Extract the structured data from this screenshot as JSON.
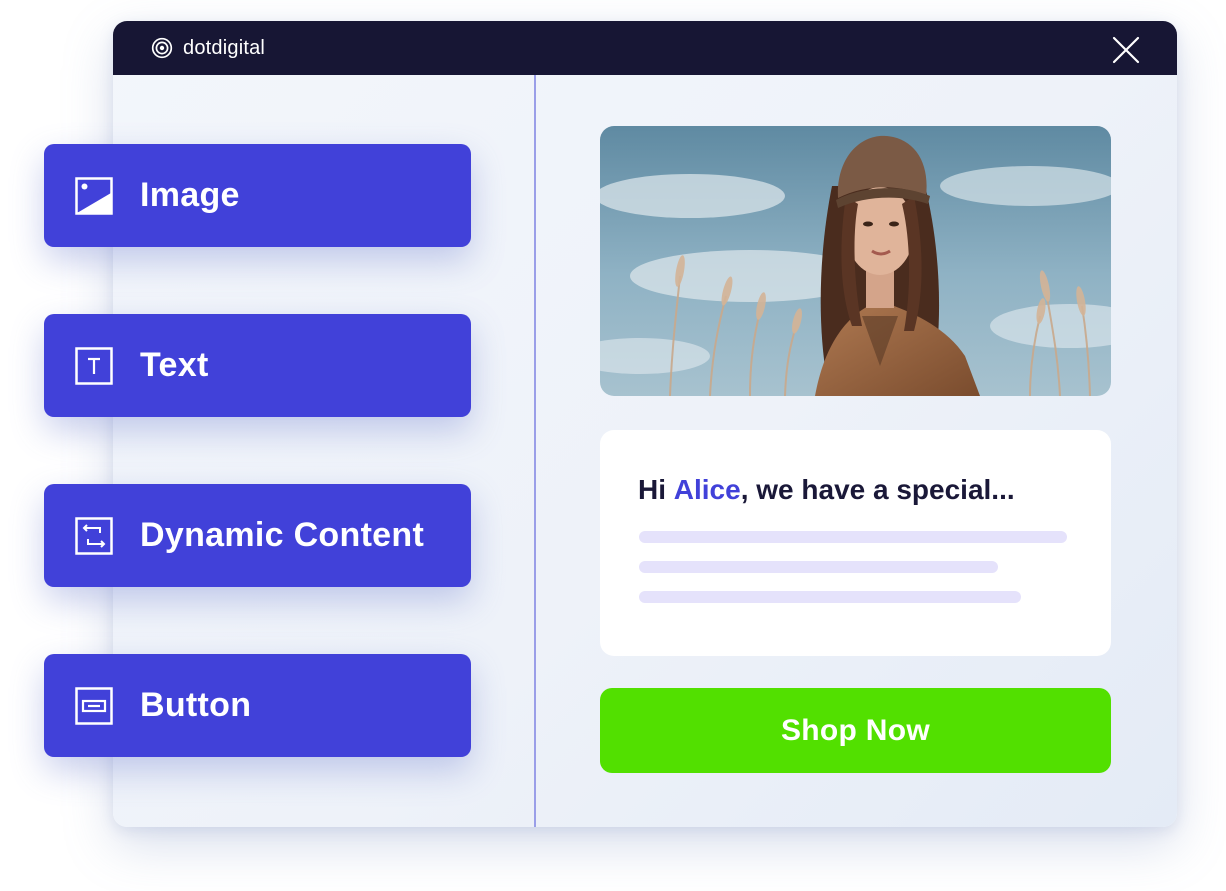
{
  "brand": {
    "name": "dotdigital",
    "icon": "concentric-circles-logo-icon"
  },
  "window": {
    "close_icon": "close-icon"
  },
  "blocks": [
    {
      "label": "Image",
      "icon": "image-icon"
    },
    {
      "label": "Text",
      "icon": "text-icon",
      "glyph": "T"
    },
    {
      "label": "Dynamic Content",
      "icon": "dynamic-content-icon"
    },
    {
      "label": "Button",
      "icon": "button-icon"
    }
  ],
  "preview": {
    "hero_image": "woman-in-field-photo",
    "greeting": {
      "prefix": "Hi ",
      "name": "Alice",
      "suffix": ", we have a special..."
    },
    "cta_label": "Shop Now"
  },
  "colors": {
    "titlebar": "#171634",
    "block_bg": "#4141d9",
    "accent": "#4141d9",
    "cta_bg": "#52e000",
    "placeholder_line": "#e5e2fb"
  }
}
